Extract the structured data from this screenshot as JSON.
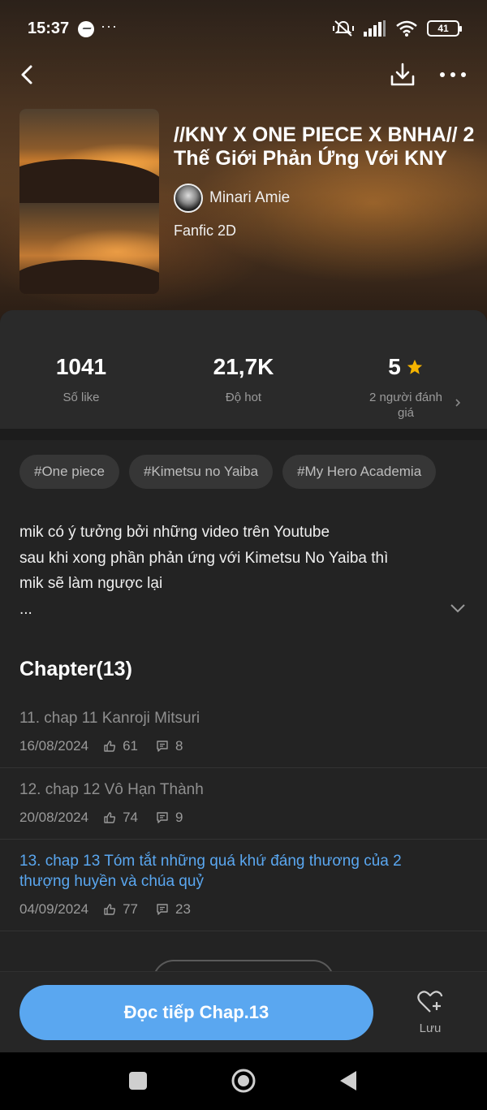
{
  "status_bar": {
    "time": "15:37",
    "dots": "···",
    "battery": "41"
  },
  "book": {
    "title": "//KNY X ONE PIECE X BNHA// 2 Thế Giới Phản Ứng Với KNY",
    "author": "Minari Amie",
    "genre": "Fanfic 2D"
  },
  "stats": {
    "likes_value": "1041",
    "likes_label": "Số like",
    "hot_value": "21,7K",
    "hot_label": "Độ hot",
    "rating_value": "5",
    "rating_label": "2 người đánh giá"
  },
  "tags": [
    "#One piece",
    "#Kimetsu no Yaiba",
    "#My Hero Academia"
  ],
  "description": {
    "line1": "mik có ý tưởng bởi những video trên Youtube",
    "line2": "sau khi xong phần phản ứng với Kimetsu No Yaiba thì",
    "line3": "mik sẽ làm ngược lại",
    "line4": "..."
  },
  "chapters": {
    "heading": "Chapter(13)",
    "items": [
      {
        "title": "11. chap 11 Kanroji Mitsuri",
        "date": "16/08/2024",
        "likes": "61",
        "comments": "8"
      },
      {
        "title": "12. chap 12 Vô Hạn Thành",
        "date": "20/08/2024",
        "likes": "74",
        "comments": "9"
      },
      {
        "title": "13. chap 13 Tóm tắt những quá khứ đáng thương của 2 thượng huyền và chúa quỷ",
        "date": "04/09/2024",
        "likes": "77",
        "comments": "23"
      }
    ]
  },
  "actions": {
    "read_label": "Đọc tiếp Chap.13",
    "save_label": "Lưu"
  },
  "colors": {
    "accent": "#5aa7f0",
    "star": "#f5b400",
    "background": "#232323"
  },
  "icons": {
    "back": "chevron-left-icon",
    "download": "download-icon",
    "more": "more-horizontal-icon",
    "star": "star-icon",
    "like": "thumbs-up-icon",
    "comment": "comment-icon",
    "save": "heart-plus-icon"
  }
}
